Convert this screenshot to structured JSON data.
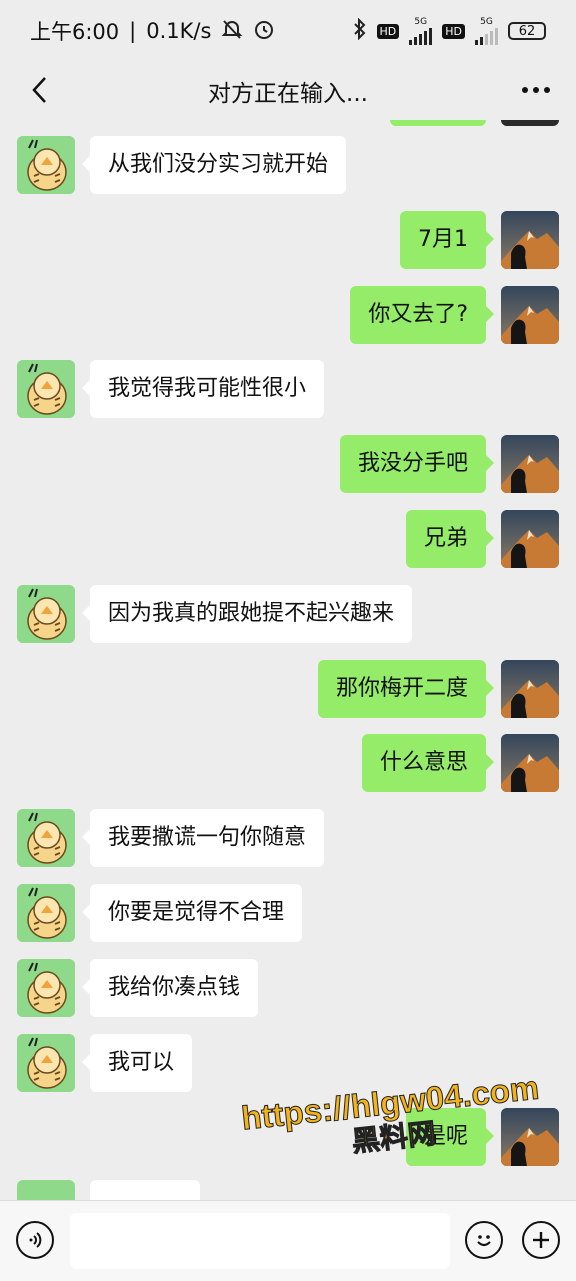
{
  "status": {
    "time": "上午6:00",
    "speed": "0.1K/s",
    "hd1": "HD",
    "net1": "5G",
    "hd2": "HD",
    "net2": "5G",
    "battery": "62"
  },
  "header": {
    "title": "对方正在输入..."
  },
  "messages": [
    {
      "side": "in",
      "text": "从我们没分实习就开始"
    },
    {
      "side": "out",
      "text": "7月1"
    },
    {
      "side": "out",
      "text": "你又去了?"
    },
    {
      "side": "in",
      "text": "我觉得我可能性很小"
    },
    {
      "side": "out",
      "text": "我没分手吧"
    },
    {
      "side": "out",
      "text": "兄弟"
    },
    {
      "side": "in",
      "text": "因为我真的跟她提不起兴趣来"
    },
    {
      "side": "out",
      "text": "那你梅开二度"
    },
    {
      "side": "out",
      "text": "什么意思"
    },
    {
      "side": "in",
      "text": "我要撒谎一句你随意"
    },
    {
      "side": "in",
      "text": "你要是觉得不合理"
    },
    {
      "side": "in",
      "text": "我给你凑点钱"
    },
    {
      "side": "in",
      "text": "我可以"
    },
    {
      "side": "out",
      "text": "是呢"
    }
  ],
  "watermark": {
    "line1": "https://hlgw04.com",
    "line2": "黑料网"
  },
  "icons": {
    "back": "back-arrow-icon",
    "more": "more-dots-icon",
    "voice": "voice-icon",
    "emoji": "emoji-icon",
    "plus": "plus-icon"
  }
}
